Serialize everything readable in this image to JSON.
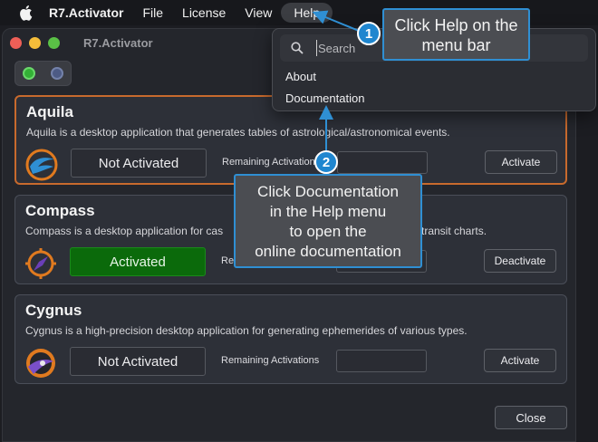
{
  "menubar": {
    "app_name": "R7.Activator",
    "items": [
      "File",
      "License",
      "View",
      "Help"
    ]
  },
  "window": {
    "title": "R7.Activator"
  },
  "products": [
    {
      "name": "Aquila",
      "description": "Aquila is a desktop application that generates tables of astrological/astronomical events.",
      "status": "Not Activated",
      "remaining_label": "Remaining Activations",
      "remaining_value": "",
      "button": "Activate"
    },
    {
      "name": "Compass",
      "description": "Compass is a desktop application for cas",
      "description_tail": "transit charts.",
      "status": "Activated",
      "remaining_label": "Re",
      "remaining_value": "",
      "button": "Deactivate"
    },
    {
      "name": "Cygnus",
      "description": "Cygnus is a high-precision desktop application for generating ephemerides of various types.",
      "status": "Not Activated",
      "remaining_label": "Remaining Activations",
      "remaining_value": "",
      "button": "Activate"
    }
  ],
  "close_button": "Close",
  "help_menu": {
    "search_placeholder": "Search",
    "items": [
      "About",
      "Documentation"
    ]
  },
  "callouts": [
    {
      "number": "1",
      "text_lines": [
        "Click Help on the",
        "menu bar"
      ]
    },
    {
      "number": "2",
      "text_lines": [
        "Click Documentation",
        "in the Help menu",
        "to open the",
        "online documentation"
      ]
    }
  ],
  "colors": {
    "selected_border": "#c86a2d",
    "activated_green": "#0b6a0b",
    "callout_blue": "#1f86cf"
  }
}
